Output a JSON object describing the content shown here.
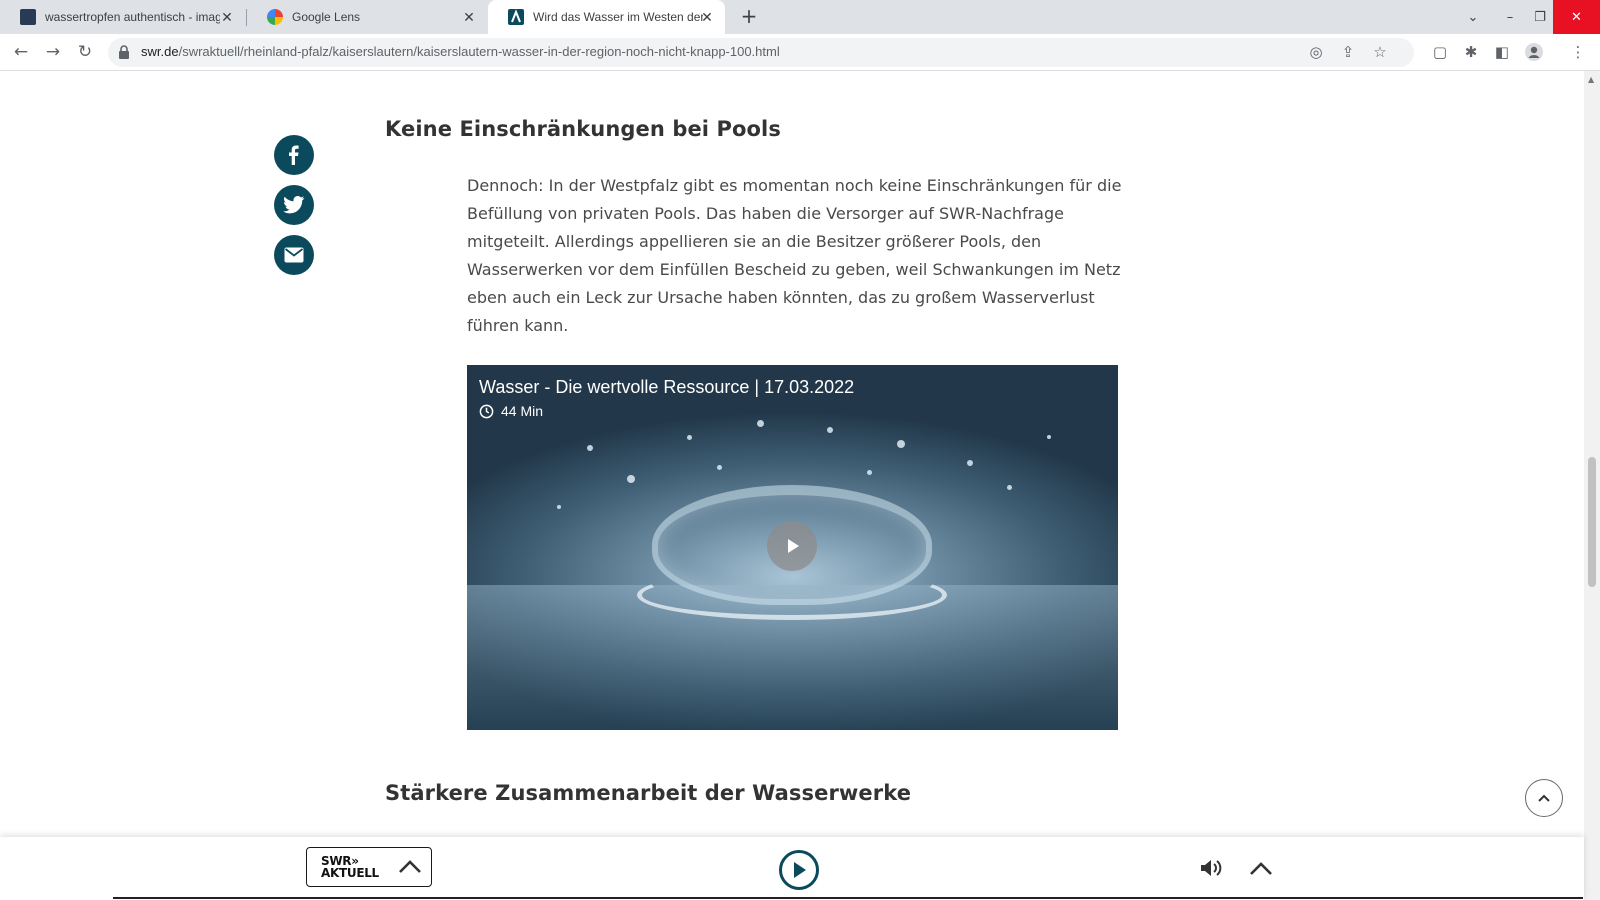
{
  "browser": {
    "tabs": [
      {
        "title": "wassertropfen authentisch - imag",
        "active": false
      },
      {
        "title": "Google Lens",
        "active": false
      },
      {
        "title": "Wird das Wasser im Westen der P",
        "active": true
      }
    ],
    "url_domain": "swr.de",
    "url_path": "/swraktuell/rheinland-pfalz/kaiserslautern/kaiserslautern-wasser-in-der-region-noch-nicht-knapp-100.html"
  },
  "article": {
    "heading1": "Keine Einschränkungen bei Pools",
    "paragraph": "Dennoch: In der Westpfalz gibt es momentan noch keine Einschränkungen für die Befüllung von privaten Pools. Das haben die Versorger auf SWR-Nachfrage mitgeteilt. Allerdings appellieren sie an die Besitzer größerer Pools, den Wasserwerken vor dem Einfüllen Bescheid zu geben, weil Schwankungen im Netz eben auch ein Leck zur Ursache haben könnten, das zu großem Wasserverlust führen kann.",
    "video": {
      "title": "Wasser - Die wertvolle Ressource | 17.03.2022",
      "duration": "44 Min"
    },
    "heading2": "Stärkere Zusammenarbeit der Wasserwerke"
  },
  "player": {
    "logo_line1": "SWR»",
    "logo_line2": "AKTUELL"
  },
  "colors": {
    "brand": "#0b4a5c",
    "close_red": "#e81123"
  }
}
